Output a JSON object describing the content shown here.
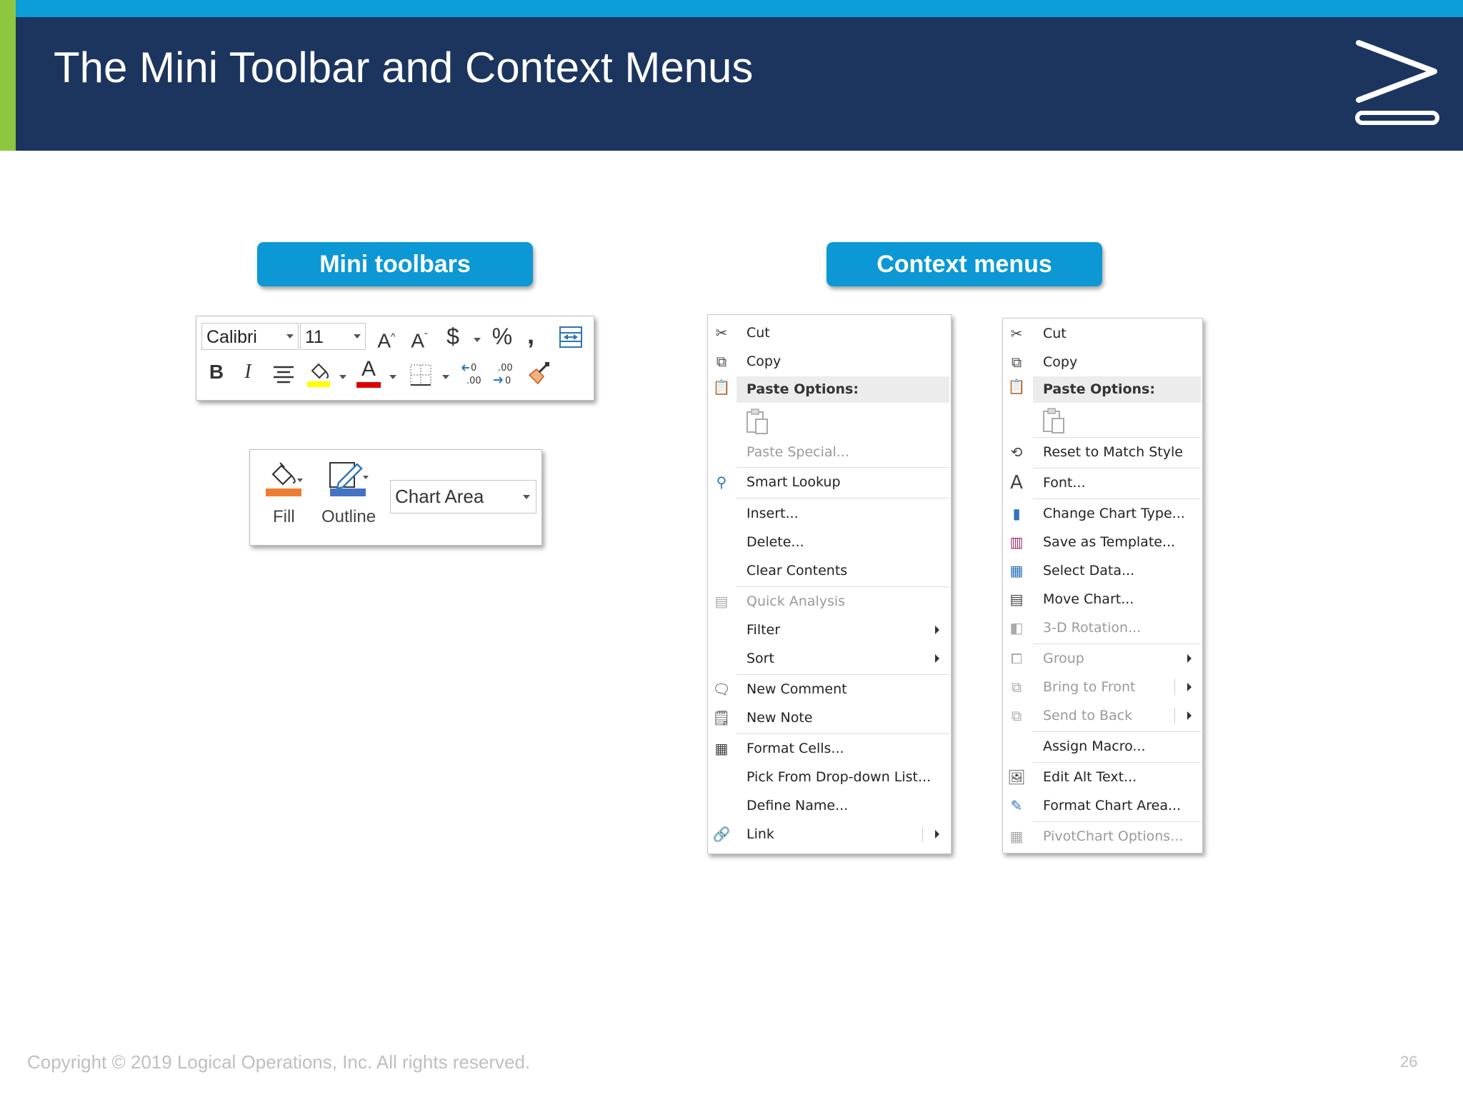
{
  "slide": {
    "title": "The Mini Toolbar and Context Menus",
    "footer": "Copyright © 2019 Logical Operations, Inc. All rights reserved.",
    "page_number": "26",
    "colors": {
      "title_bar": "#1b355f",
      "accent_strip": "#0c9ed8",
      "left_bar": "#8dc63f",
      "pill": "#0b98d5"
    }
  },
  "labels": {
    "mini_toolbars": "Mini toolbars",
    "context_menus": "Context menus"
  },
  "mini_toolbar_1": {
    "font_name": "Calibri",
    "font_size": "11",
    "icons": [
      "increase-font-size-icon",
      "decrease-font-size-icon",
      "accounting-format-icon",
      "percent-style-icon",
      "comma-style-icon",
      "merge-center-icon",
      "bold-icon",
      "italic-icon",
      "center-align-icon",
      "fill-color-icon",
      "font-color-icon",
      "borders-icon",
      "increase-decimal-icon",
      "decrease-decimal-icon",
      "format-painter-icon"
    ],
    "fill_accent": "#ffff00",
    "font_accent": "#e00000"
  },
  "mini_toolbar_2": {
    "fill_label": "Fill",
    "outline_label": "Outline",
    "chart_element": "Chart Area",
    "fill_color": "#ed7d31",
    "outline_color": "#4472c4"
  },
  "context_menu_1": {
    "cut": "Cut",
    "copy": "Copy",
    "paste_options": "Paste Options:",
    "paste_special": "Paste Special...",
    "smart_lookup": "Smart Lookup",
    "insert": "Insert...",
    "delete": "Delete...",
    "clear_contents": "Clear Contents",
    "quick_analysis": "Quick Analysis",
    "filter": "Filter",
    "sort": "Sort",
    "new_comment": "New Comment",
    "new_note": "New Note",
    "format_cells": "Format Cells...",
    "pick_from_list": "Pick From Drop-down List...",
    "define_name": "Define Name...",
    "link": "Link"
  },
  "context_menu_2": {
    "cut": "Cut",
    "copy": "Copy",
    "paste_options": "Paste Options:",
    "reset_match_style": "Reset to Match Style",
    "font": "Font...",
    "change_chart_type": "Change Chart Type...",
    "save_as_template": "Save as Template...",
    "select_data": "Select Data...",
    "move_chart": "Move Chart...",
    "rotation_3d": "3-D Rotation...",
    "group": "Group",
    "bring_to_front": "Bring to Front",
    "send_to_back": "Send to Back",
    "assign_macro": "Assign Macro...",
    "edit_alt_text": "Edit Alt Text...",
    "format_chart_area": "Format Chart Area...",
    "pivotchart_options": "PivotChart Options..."
  }
}
